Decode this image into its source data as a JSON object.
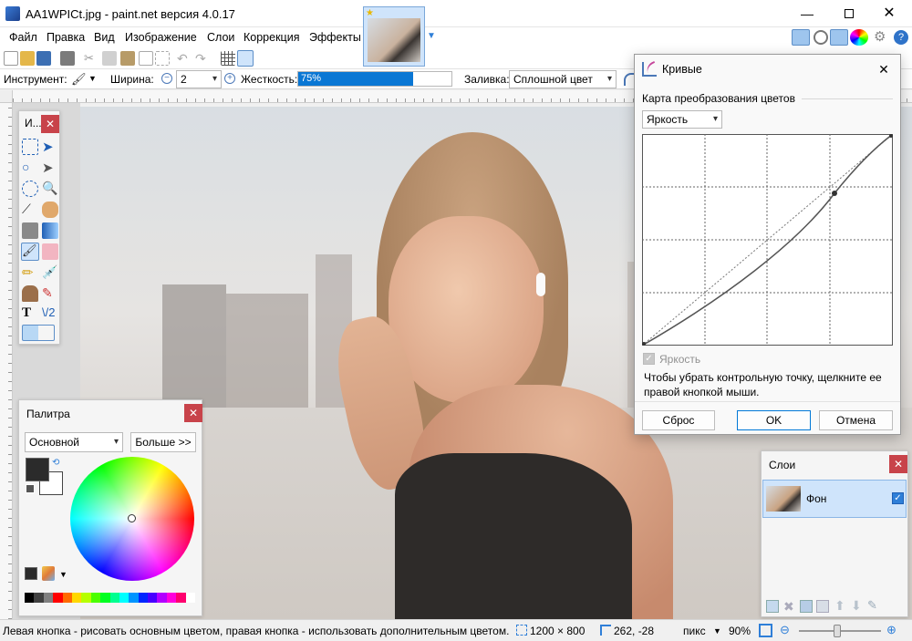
{
  "window": {
    "title": "AA1WPICt.jpg - paint.net версия 4.0.17"
  },
  "menu": {
    "items": [
      "Файл",
      "Правка",
      "Вид",
      "Изображение",
      "Слои",
      "Коррекция",
      "Эффекты"
    ]
  },
  "toolbar": {
    "tool_label": "Инструмент:",
    "width_label": "Ширина:",
    "width_value": "2",
    "hardness_label": "Жесткость:",
    "hardness_value": "75%",
    "hardness_fraction": 0.75,
    "fill_label": "Заливка:",
    "fill_value": "Сплошной цвет"
  },
  "tools_panel": {
    "title": "И..."
  },
  "palette": {
    "title": "Палитра",
    "mode": "Основной",
    "more_button": "Больше >>",
    "primary_color": "#2b2b2b",
    "secondary_color": "#ffffff",
    "swatches": [
      "#000000",
      "#404040",
      "#808080",
      "#ff0000",
      "#ff6a00",
      "#ffd800",
      "#b6ff00",
      "#4cff00",
      "#00ff21",
      "#00ff90",
      "#00ffff",
      "#0094ff",
      "#0026ff",
      "#4800ff",
      "#b200ff",
      "#ff00dc",
      "#ff006e",
      "#ffffff"
    ]
  },
  "curves": {
    "title": "Кривые",
    "transfer_label": "Карта преобразования цветов",
    "mode": "Яркость",
    "checkbox_label": "Яркость",
    "hint": "Чтобы убрать контрольную точку, щелкните ее правой кнопкой мыши.",
    "reset_button": "Сброс",
    "ok_button": "OK",
    "cancel_button": "Отмена"
  },
  "layers": {
    "title": "Слои",
    "items": [
      {
        "name": "Фон",
        "visible": true
      }
    ]
  },
  "status": {
    "hint": "Левая кнопка - рисовать основным цветом, правая кнопка - использовать дополнительным цветом.",
    "image_size": "1200 × 800",
    "cursor_pos": "262, -28",
    "units": "пикс",
    "zoom": "90%"
  },
  "colors": {
    "accent": "#0078d7",
    "close_red": "#c8434a",
    "hardness_fill": "#0a77d4"
  }
}
